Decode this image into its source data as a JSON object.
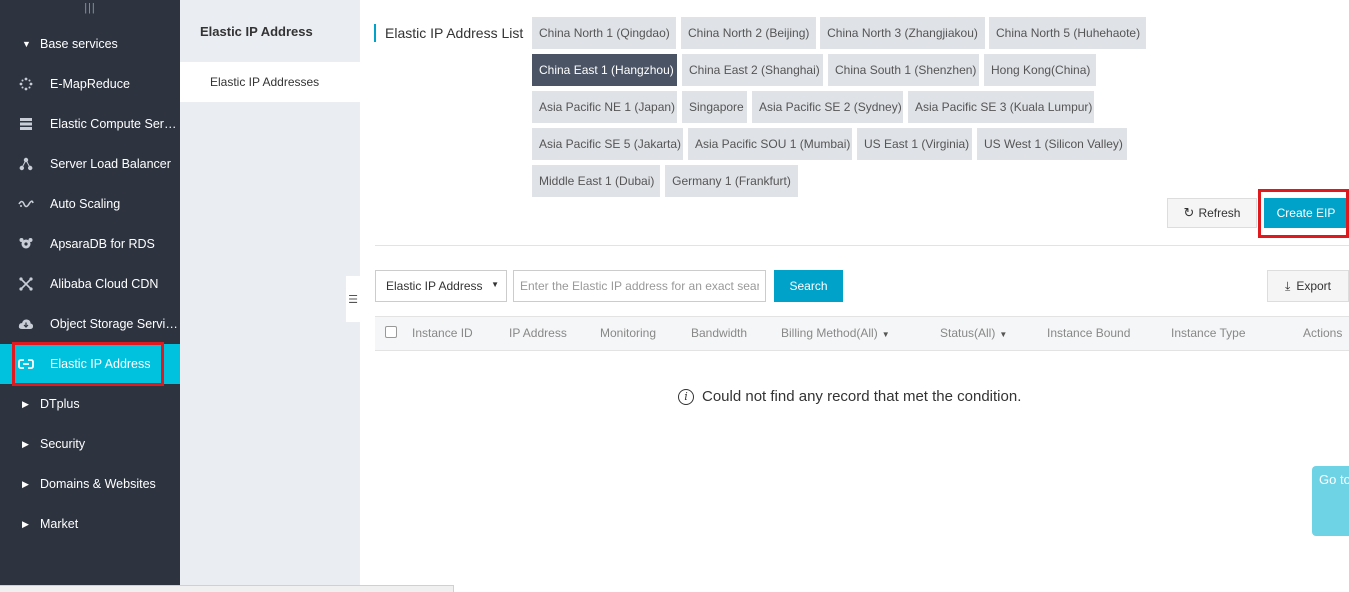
{
  "sidebar": {
    "grip": "|||",
    "base_group": "Base services",
    "items": [
      {
        "label": "E-MapReduce",
        "icon": "e-mapreduce-icon"
      },
      {
        "label": "Elastic Compute Service",
        "icon": "server-icon"
      },
      {
        "label": "Server Load Balancer",
        "icon": "load-balancer-icon"
      },
      {
        "label": "Auto Scaling",
        "icon": "auto-scaling-icon"
      },
      {
        "label": "ApsaraDB for RDS",
        "icon": "database-icon"
      },
      {
        "label": "Alibaba Cloud CDN",
        "icon": "cdn-icon"
      },
      {
        "label": "Object Storage Service",
        "icon": "cloud-storage-icon"
      },
      {
        "label": "Elastic IP Address",
        "icon": "elastic-ip-icon",
        "active": true
      }
    ],
    "groups": [
      "DTplus",
      "Security",
      "Domains & Websites",
      "Market"
    ]
  },
  "subnav": {
    "title": "Elastic IP Address",
    "selected": "Elastic IP Addresses"
  },
  "main": {
    "title": "Elastic IP Address List",
    "regions": [
      "China North 1 (Qingdao)",
      "China North 2 (Beijing)",
      "China North 3 (Zhangjiakou)",
      "China North 5 (Huhehaote)",
      "China East 1 (Hangzhou)",
      "China East 2 (Shanghai)",
      "China South 1 (Shenzhen)",
      "Hong Kong(China)",
      "Asia Pacific NE 1 (Japan)",
      "Singapore",
      "Asia Pacific SE 2 (Sydney)",
      "Asia Pacific SE 3 (Kuala Lumpur)",
      "Asia Pacific SE 5 (Jakarta)",
      "Asia Pacific SOU 1 (Mumbai)",
      "US East 1 (Virginia)",
      "US West 1 (Silicon Valley)",
      "Middle East 1 (Dubai)",
      "Germany 1 (Frankfurt)"
    ],
    "active_region": "China East 1 (Hangzhou)",
    "refresh_label": "Refresh",
    "create_label": "Create EIP",
    "filter_select": "Elastic IP Address",
    "search_placeholder": "Enter the Elastic IP address for an exact search",
    "search_label": "Search",
    "export_label": "Export",
    "columns": [
      "Instance ID",
      "IP Address",
      "Monitoring",
      "Bandwidth",
      "Billing Method(All)",
      "Status(All)",
      "Instance Bound",
      "Instance Type",
      "Actions"
    ],
    "empty_message": "Could not find any record that met the condition.",
    "go_new_version": "Go to New Version"
  },
  "colors": {
    "sidebar_bg": "#2d3440",
    "accent": "#00c1de",
    "primary_button": "#00a2ca",
    "active_region": "#4a5464",
    "highlight": "#e0191f"
  }
}
